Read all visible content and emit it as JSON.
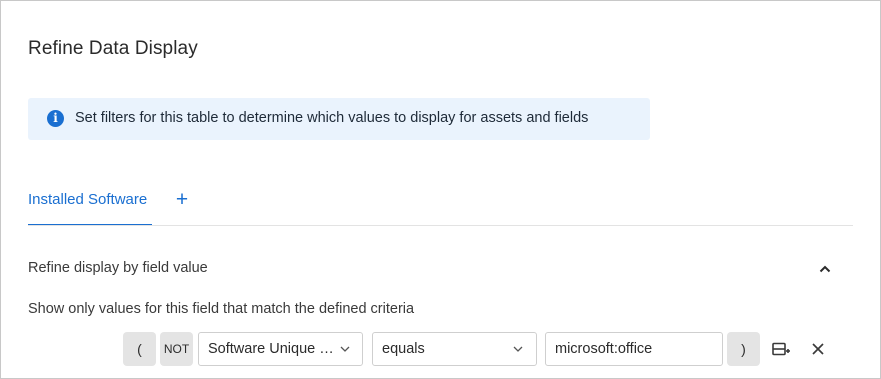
{
  "dialog": {
    "title": "Refine Data Display",
    "info_message": "Set filters for this table to determine which values to display for assets and fields"
  },
  "tabs": [
    {
      "label": "Installed Software",
      "active": true
    }
  ],
  "add_tab_symbol": "+",
  "section": {
    "title": "Refine display by field value",
    "description": "Show only values for this field that match the defined criteria",
    "expanded": true
  },
  "filter_row": {
    "open_paren": "(",
    "not_label": "NOT",
    "field_value": "Software Unique …",
    "operator_value": "equals",
    "criteria_value": "microsoft:office",
    "close_paren": ")"
  },
  "icons": {
    "info": "info-icon",
    "add": "plus-icon",
    "collapse": "chevron-up-icon",
    "dropdown": "chevron-down-icon",
    "add_row": "add-row-icon",
    "remove": "close-icon"
  },
  "colors": {
    "accent": "#1a6fd1",
    "info_background": "#eaf3fd",
    "chip_background": "#e4e4e4"
  }
}
